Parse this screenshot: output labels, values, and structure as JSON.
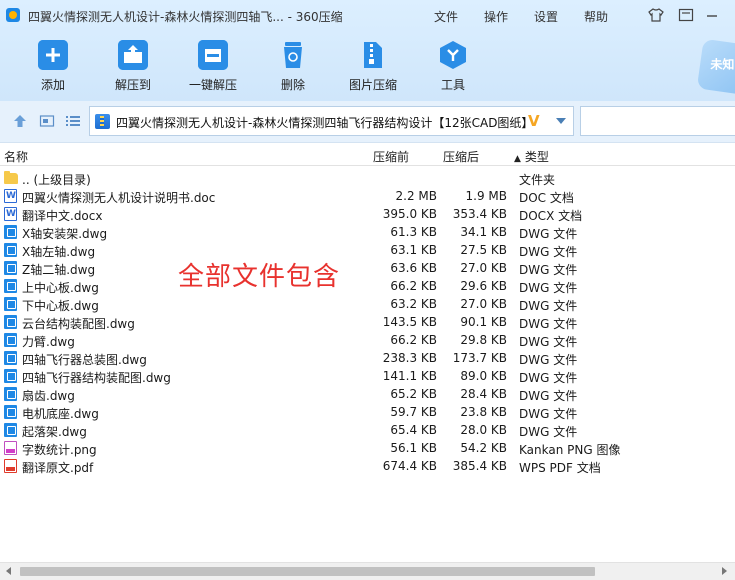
{
  "window": {
    "title": "四翼火情探测无人机设计-森林火情探测四轴飞... - 360压缩"
  },
  "menu": [
    "文件",
    "操作",
    "设置",
    "帮助"
  ],
  "toolbar": {
    "add": "添加",
    "extract_to": "解压到",
    "one_click_extract": "一键解压",
    "delete": "删除",
    "image_compress": "图片压缩",
    "tools": "工具"
  },
  "badge": {
    "label": "未知"
  },
  "address": {
    "path": "四翼火情探测无人机设计-森林火情探测四轴飞行器结构设计【12张CAD图纸】",
    "mark": "V"
  },
  "columns": {
    "name": "名称",
    "size": "压缩前",
    "packed": "压缩后",
    "type": "类型",
    "sort_arrow": "▲"
  },
  "files": [
    {
      "name": ".. (上级目录)",
      "size": "",
      "packed": "",
      "type": "文件夹",
      "icon": "folder-icon",
      "kind": "folder"
    },
    {
      "name": "四翼火情探测无人机设计说明书.doc",
      "size": "2.2 MB",
      "packed": "1.9 MB",
      "type": "DOC 文档",
      "icon": "word-doc-icon",
      "kind": "doc"
    },
    {
      "name": "翻译中文.docx",
      "size": "395.0 KB",
      "packed": "353.4 KB",
      "type": "DOCX 文档",
      "icon": "word-doc-icon",
      "kind": "doc"
    },
    {
      "name": "X轴安装架.dwg",
      "size": "61.3 KB",
      "packed": "34.1 KB",
      "type": "DWG 文件",
      "icon": "dwg-file-icon",
      "kind": "dwg"
    },
    {
      "name": "X轴左轴.dwg",
      "size": "63.1 KB",
      "packed": "27.5 KB",
      "type": "DWG 文件",
      "icon": "dwg-file-icon",
      "kind": "dwg"
    },
    {
      "name": "Z轴二轴.dwg",
      "size": "63.6 KB",
      "packed": "27.0 KB",
      "type": "DWG 文件",
      "icon": "dwg-file-icon",
      "kind": "dwg"
    },
    {
      "name": "上中心板.dwg",
      "size": "66.2 KB",
      "packed": "29.6 KB",
      "type": "DWG 文件",
      "icon": "dwg-file-icon",
      "kind": "dwg"
    },
    {
      "name": "下中心板.dwg",
      "size": "63.2 KB",
      "packed": "27.0 KB",
      "type": "DWG 文件",
      "icon": "dwg-file-icon",
      "kind": "dwg"
    },
    {
      "name": "云台结构装配图.dwg",
      "size": "143.5 KB",
      "packed": "90.1 KB",
      "type": "DWG 文件",
      "icon": "dwg-file-icon",
      "kind": "dwg"
    },
    {
      "name": "力臂.dwg",
      "size": "66.2 KB",
      "packed": "29.8 KB",
      "type": "DWG 文件",
      "icon": "dwg-file-icon",
      "kind": "dwg"
    },
    {
      "name": "四轴飞行器总装图.dwg",
      "size": "238.3 KB",
      "packed": "173.7 KB",
      "type": "DWG 文件",
      "icon": "dwg-file-icon",
      "kind": "dwg"
    },
    {
      "name": "四轴飞行器结构装配图.dwg",
      "size": "141.1 KB",
      "packed": "89.0 KB",
      "type": "DWG 文件",
      "icon": "dwg-file-icon",
      "kind": "dwg"
    },
    {
      "name": "扇齿.dwg",
      "size": "65.2 KB",
      "packed": "28.4 KB",
      "type": "DWG 文件",
      "icon": "dwg-file-icon",
      "kind": "dwg"
    },
    {
      "name": "电机底座.dwg",
      "size": "59.7 KB",
      "packed": "23.8 KB",
      "type": "DWG 文件",
      "icon": "dwg-file-icon",
      "kind": "dwg"
    },
    {
      "name": "起落架.dwg",
      "size": "65.4 KB",
      "packed": "28.0 KB",
      "type": "DWG 文件",
      "icon": "dwg-file-icon",
      "kind": "dwg"
    },
    {
      "name": "字数统计.png",
      "size": "56.1 KB",
      "packed": "54.2 KB",
      "type": "Kankan PNG 图像",
      "icon": "png-image-icon",
      "kind": "png"
    },
    {
      "name": "翻译原文.pdf",
      "size": "674.4 KB",
      "packed": "385.4 KB",
      "type": "WPS PDF 文档",
      "icon": "pdf-file-icon",
      "kind": "pdf"
    }
  ],
  "overlay": "全部文件包含",
  "colors": {
    "accent": "#2196f3",
    "overlay_text": "#e8322e",
    "address_mark": "#f5a623"
  }
}
